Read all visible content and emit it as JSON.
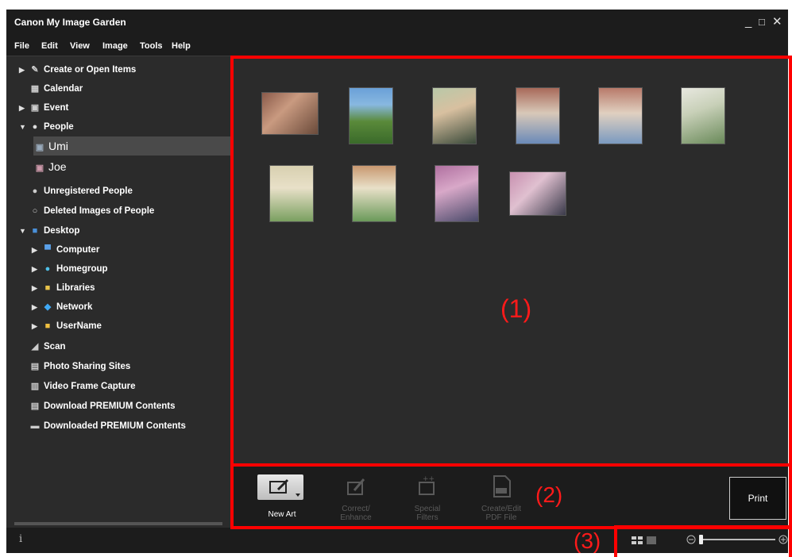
{
  "window": {
    "title": "Canon My Image Garden",
    "minimize_glyph": "_",
    "maximize_glyph": "□",
    "close_glyph": "✕"
  },
  "menu": [
    "File",
    "Edit",
    "View",
    "Image",
    "Tools",
    "Help"
  ],
  "sidebar": {
    "items": [
      {
        "label": "Create or Open Items",
        "icon": "create-items-icon",
        "arrow": "▶",
        "selected": false
      },
      {
        "label": "Calendar",
        "icon": "calendar-icon",
        "arrow": "",
        "selected": false
      },
      {
        "label": "Event",
        "icon": "event-icon",
        "arrow": "▶",
        "selected": false
      },
      {
        "label": "People",
        "icon": "person-icon",
        "arrow": "▼",
        "selected": false
      },
      {
        "label": "Umi",
        "icon": "person-photo-icon",
        "arrow": "",
        "selected": true
      },
      {
        "label": "Joe",
        "icon": "person-photo-icon",
        "arrow": "",
        "selected": false
      },
      {
        "label": "Unregistered People",
        "icon": "unregistered-person-icon",
        "arrow": "",
        "selected": false
      },
      {
        "label": "Deleted Images of People",
        "icon": "deleted-person-icon",
        "arrow": "",
        "selected": false
      },
      {
        "label": "Desktop",
        "icon": "desktop-icon",
        "arrow": "▼",
        "selected": false
      },
      {
        "label": "Computer",
        "icon": "computer-icon",
        "arrow": "▶",
        "selected": false
      },
      {
        "label": "Homegroup",
        "icon": "homegroup-icon",
        "arrow": "▶",
        "selected": false
      },
      {
        "label": "Libraries",
        "icon": "libraries-icon",
        "arrow": "▶",
        "selected": false
      },
      {
        "label": "Network",
        "icon": "network-icon",
        "arrow": "▶",
        "selected": false
      },
      {
        "label": "UserName",
        "icon": "user-folder-icon",
        "arrow": "▶",
        "selected": false
      },
      {
        "label": "Scan",
        "icon": "scan-icon",
        "arrow": "",
        "selected": false
      },
      {
        "label": "Photo Sharing Sites",
        "icon": "photo-sharing-icon",
        "arrow": "",
        "selected": false
      },
      {
        "label": "Video Frame Capture",
        "icon": "video-frame-icon",
        "arrow": "",
        "selected": false
      },
      {
        "label": "Download PREMIUM Contents",
        "icon": "download-premium-icon",
        "arrow": "",
        "selected": false
      },
      {
        "label": "Downloaded PREMIUM Contents",
        "icon": "downloaded-premium-icon",
        "arrow": "",
        "selected": false
      }
    ]
  },
  "actions": {
    "new_art": "New Art",
    "correct_enhance_1": "Correct/",
    "correct_enhance_2": "Enhance",
    "special_filters_1": "Special",
    "special_filters_2": "Filters",
    "create_pdf_1": "Create/Edit",
    "create_pdf_2": "PDF File",
    "print": "Print"
  },
  "overlays": {
    "area1": "(1)",
    "area2": "(2)",
    "area3": "(3)"
  },
  "status": {
    "info_glyph": "i"
  },
  "colors": {
    "highlight": "#ff0000",
    "background": "#2b2b2b",
    "bar": "#1c1c1c"
  }
}
